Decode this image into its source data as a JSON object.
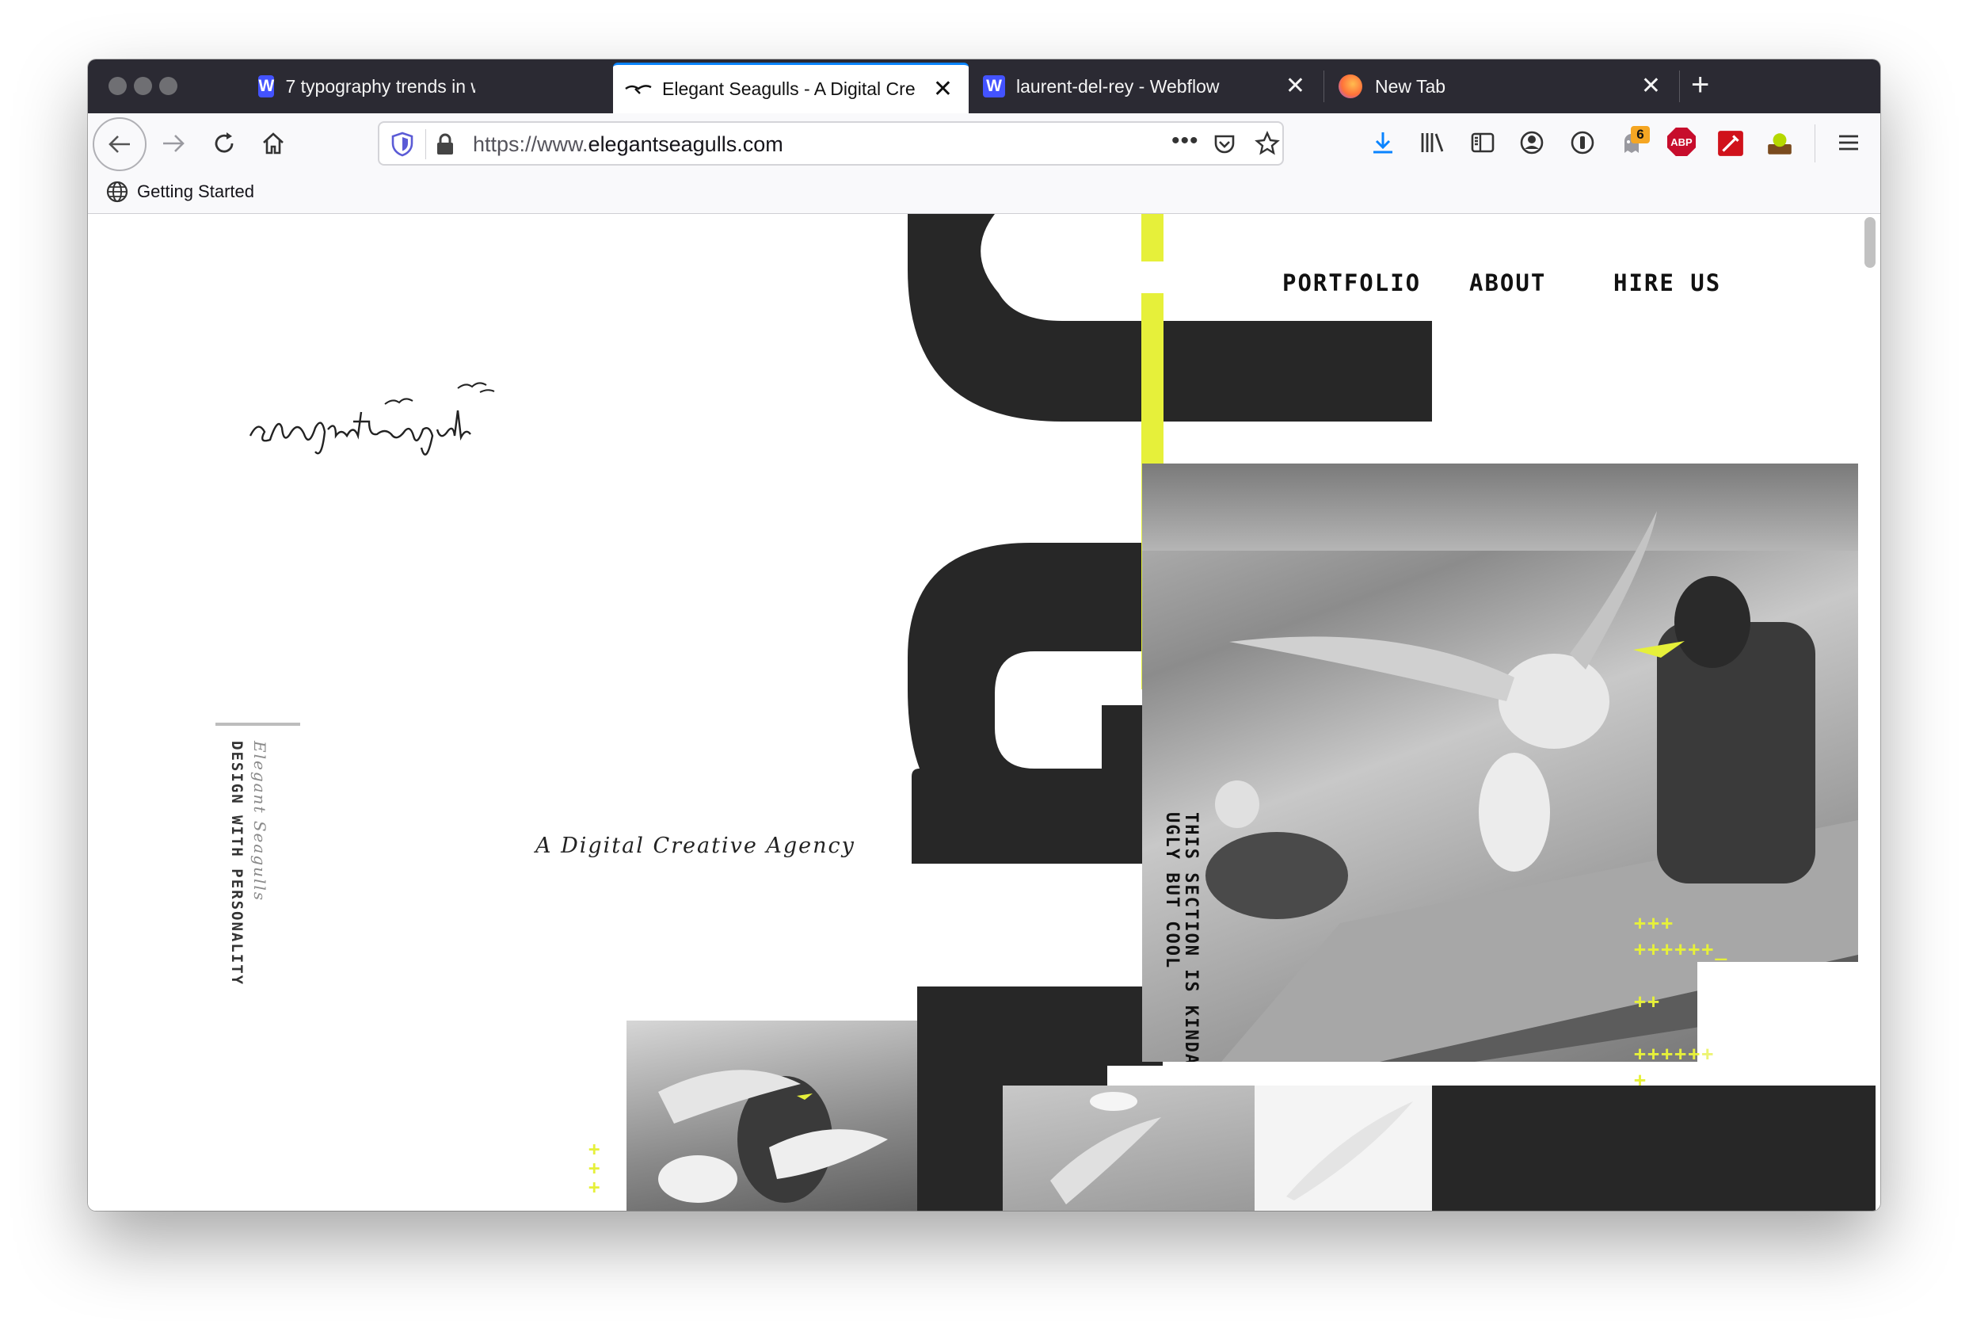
{
  "browser": {
    "tabs": [
      {
        "title": "7 typography trends in web des",
        "favicon": "W",
        "active": false
      },
      {
        "title": "Elegant Seagulls - A Digital Cre",
        "favicon": "seagull",
        "active": true
      },
      {
        "title": "laurent-del-rey - Webflow",
        "favicon": "W",
        "active": false
      },
      {
        "title": "New Tab",
        "favicon": "firefox",
        "active": false
      }
    ],
    "new_tab": "+",
    "url_scheme": "https://www.",
    "url_host": "elegantseagulls.com",
    "bookmark": "Getting Started",
    "notification_badge": "6",
    "abp_label": "ABP"
  },
  "site": {
    "nav": [
      "PORTFOLIO",
      "ABOUT",
      "HIRE US"
    ],
    "logo_text": "elegantseagulls",
    "side_script": "Elegant Seagulls",
    "side_caption": "DESIGN WITH PERSONALITY",
    "tagline": "A Digital Creative Agency",
    "photo_caption_line1": "THIS SECTION IS KINDA",
    "photo_caption_line2": "UGLY BUT COOL"
  },
  "colors": {
    "accent_yellow": "#e6f03a",
    "dark_block": "#272727",
    "tab_strip": "#2b2a33",
    "active_tab_line": "#0a84ff"
  }
}
